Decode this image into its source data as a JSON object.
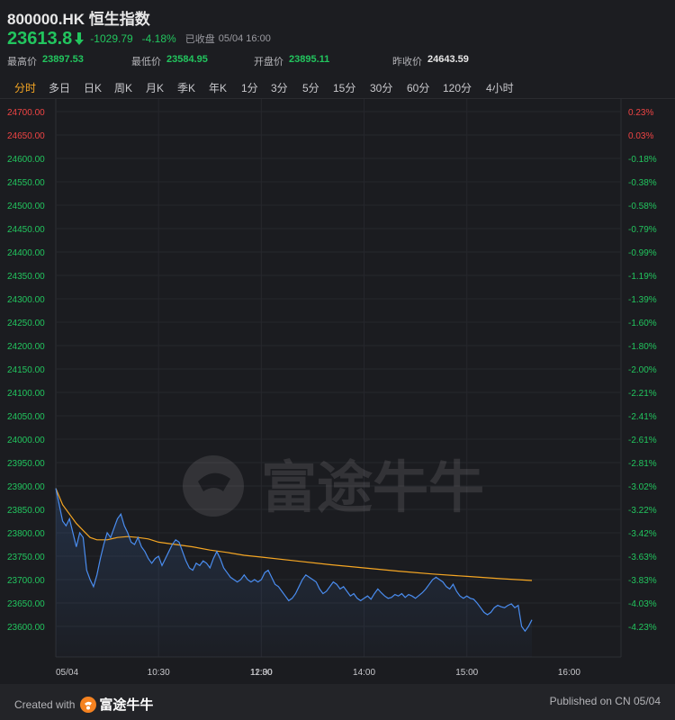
{
  "header": {
    "title": "800000.HK 恒生指数",
    "price": "23613.8",
    "change": "-1029.79",
    "change_pct": "-4.18%",
    "status": "已收盘",
    "time": "05/04 16:00",
    "stats": [
      {
        "label": "最高价",
        "value": "23897.53"
      },
      {
        "label": "最低价",
        "value": "23584.95"
      },
      {
        "label": "开盘价",
        "value": "23895.11"
      },
      {
        "label": "昨收价",
        "value": "24643.59"
      }
    ]
  },
  "tabs": [
    "分时",
    "多日",
    "日K",
    "周K",
    "月K",
    "季K",
    "年K",
    "1分",
    "3分",
    "5分",
    "15分",
    "30分",
    "60分",
    "120分",
    "4小时"
  ],
  "active_tab": "分时",
  "colors": {
    "up": "#ef4444",
    "down": "#22c55e",
    "price_line": "#4a8df0",
    "avg_line": "#f5a623",
    "active_tab": "#f5a623"
  },
  "watermark": "富途牛牛",
  "chart_data": {
    "type": "line",
    "prev_close": 24643.59,
    "ylim": [
      23575,
      24720
    ],
    "left_ticks": [
      "24700.00",
      "24650.00",
      "24600.00",
      "24550.00",
      "24500.00",
      "24450.00",
      "24400.00",
      "24350.00",
      "24300.00",
      "24250.00",
      "24200.00",
      "24150.00",
      "24100.00",
      "24050.00",
      "24000.00",
      "23950.00",
      "23900.00",
      "23850.00",
      "23800.00",
      "23750.00",
      "23700.00",
      "23650.00",
      "23600.00"
    ],
    "right_ticks": [
      "0.23%",
      "0.03%",
      "-0.18%",
      "-0.38%",
      "-0.58%",
      "-0.79%",
      "-0.99%",
      "-1.19%",
      "-1.39%",
      "-1.60%",
      "-1.80%",
      "-2.00%",
      "-2.21%",
      "-2.41%",
      "-2.61%",
      "-2.81%",
      "-3.02%",
      "-3.22%",
      "-3.42%",
      "-3.63%",
      "-3.83%",
      "-4.03%",
      "-4.23%"
    ],
    "x_labels": [
      {
        "label": "05/04",
        "t": "09:30"
      },
      {
        "label": "10:30",
        "t": "10:30"
      },
      {
        "label": "11:30",
        "t": "11:30"
      },
      {
        "label": "12:00",
        "t": "13:00"
      },
      {
        "label": "14:00",
        "t": "14:00"
      },
      {
        "label": "15:00",
        "t": "15:00"
      },
      {
        "label": "16:00",
        "t": "16:00"
      }
    ],
    "series": [
      {
        "values": [
          [
            "09:30",
            23895
          ],
          [
            "09:32",
            23860
          ],
          [
            "09:34",
            23825
          ],
          [
            "09:36",
            23815
          ],
          [
            "09:38",
            23830
          ],
          [
            "09:40",
            23800
          ],
          [
            "09:42",
            23770
          ],
          [
            "09:44",
            23800
          ],
          [
            "09:46",
            23790
          ],
          [
            "09:48",
            23720
          ],
          [
            "09:50",
            23700
          ],
          [
            "09:52",
            23685
          ],
          [
            "09:54",
            23710
          ],
          [
            "09:56",
            23745
          ],
          [
            "09:58",
            23775
          ],
          [
            "10:00",
            23800
          ],
          [
            "10:02",
            23790
          ],
          [
            "10:04",
            23810
          ],
          [
            "10:06",
            23830
          ],
          [
            "10:08",
            23840
          ],
          [
            "10:10",
            23815
          ],
          [
            "10:12",
            23800
          ],
          [
            "10:14",
            23780
          ],
          [
            "10:16",
            23775
          ],
          [
            "10:18",
            23790
          ],
          [
            "10:20",
            23770
          ],
          [
            "10:22",
            23760
          ],
          [
            "10:24",
            23745
          ],
          [
            "10:26",
            23735
          ],
          [
            "10:28",
            23745
          ],
          [
            "10:30",
            23750
          ],
          [
            "10:32",
            23730
          ],
          [
            "10:34",
            23745
          ],
          [
            "10:36",
            23760
          ],
          [
            "10:38",
            23775
          ],
          [
            "10:40",
            23785
          ],
          [
            "10:42",
            23780
          ],
          [
            "10:44",
            23760
          ],
          [
            "10:46",
            23740
          ],
          [
            "10:48",
            23725
          ],
          [
            "10:50",
            23720
          ],
          [
            "10:52",
            23735
          ],
          [
            "10:54",
            23730
          ],
          [
            "10:56",
            23740
          ],
          [
            "10:58",
            23735
          ],
          [
            "11:00",
            23725
          ],
          [
            "11:02",
            23745
          ],
          [
            "11:04",
            23760
          ],
          [
            "11:06",
            23745
          ],
          [
            "11:08",
            23725
          ],
          [
            "11:10",
            23715
          ],
          [
            "11:12",
            23705
          ],
          [
            "11:14",
            23700
          ],
          [
            "11:16",
            23695
          ],
          [
            "11:18",
            23700
          ],
          [
            "11:20",
            23710
          ],
          [
            "11:22",
            23700
          ],
          [
            "11:24",
            23695
          ],
          [
            "11:26",
            23700
          ],
          [
            "11:28",
            23695
          ],
          [
            "11:30",
            23700
          ],
          [
            "13:00",
            23700
          ],
          [
            "13:02",
            23715
          ],
          [
            "13:04",
            23720
          ],
          [
            "13:06",
            23705
          ],
          [
            "13:08",
            23690
          ],
          [
            "13:10",
            23685
          ],
          [
            "13:12",
            23675
          ],
          [
            "13:14",
            23665
          ],
          [
            "13:16",
            23655
          ],
          [
            "13:18",
            23660
          ],
          [
            "13:20",
            23670
          ],
          [
            "13:22",
            23685
          ],
          [
            "13:24",
            23700
          ],
          [
            "13:26",
            23710
          ],
          [
            "13:28",
            23705
          ],
          [
            "13:30",
            23700
          ],
          [
            "13:32",
            23695
          ],
          [
            "13:34",
            23680
          ],
          [
            "13:36",
            23670
          ],
          [
            "13:38",
            23675
          ],
          [
            "13:40",
            23685
          ],
          [
            "13:42",
            23695
          ],
          [
            "13:44",
            23690
          ],
          [
            "13:46",
            23680
          ],
          [
            "13:48",
            23685
          ],
          [
            "13:50",
            23675
          ],
          [
            "13:52",
            23665
          ],
          [
            "13:54",
            23670
          ],
          [
            "13:56",
            23660
          ],
          [
            "13:58",
            23655
          ],
          [
            "14:00",
            23660
          ],
          [
            "14:02",
            23665
          ],
          [
            "14:04",
            23658
          ],
          [
            "14:06",
            23670
          ],
          [
            "14:08",
            23680
          ],
          [
            "14:10",
            23672
          ],
          [
            "14:12",
            23665
          ],
          [
            "14:14",
            23660
          ],
          [
            "14:16",
            23662
          ],
          [
            "14:18",
            23668
          ],
          [
            "14:20",
            23665
          ],
          [
            "14:22",
            23670
          ],
          [
            "14:24",
            23662
          ],
          [
            "14:26",
            23668
          ],
          [
            "14:28",
            23665
          ],
          [
            "14:30",
            23660
          ],
          [
            "14:32",
            23666
          ],
          [
            "14:34",
            23672
          ],
          [
            "14:36",
            23680
          ],
          [
            "14:38",
            23690
          ],
          [
            "14:40",
            23700
          ],
          [
            "14:42",
            23705
          ],
          [
            "14:44",
            23700
          ],
          [
            "14:46",
            23695
          ],
          [
            "14:48",
            23685
          ],
          [
            "14:50",
            23680
          ],
          [
            "14:52",
            23690
          ],
          [
            "14:54",
            23675
          ],
          [
            "14:56",
            23665
          ],
          [
            "14:58",
            23660
          ],
          [
            "15:00",
            23665
          ],
          [
            "15:02",
            23660
          ],
          [
            "15:04",
            23658
          ],
          [
            "15:06",
            23650
          ],
          [
            "15:08",
            23640
          ],
          [
            "15:10",
            23630
          ],
          [
            "15:12",
            23625
          ],
          [
            "15:14",
            23630
          ],
          [
            "15:16",
            23640
          ],
          [
            "15:18",
            23645
          ],
          [
            "15:20",
            23642
          ],
          [
            "15:22",
            23640
          ],
          [
            "15:24",
            23645
          ],
          [
            "15:26",
            23648
          ],
          [
            "15:28",
            23640
          ],
          [
            "15:30",
            23645
          ],
          [
            "15:32",
            23600
          ],
          [
            "15:34",
            23590
          ],
          [
            "15:36",
            23600
          ],
          [
            "15:38",
            23614
          ]
        ]
      },
      {
        "values": [
          [
            "09:30",
            23895
          ],
          [
            "09:34",
            23860
          ],
          [
            "09:38",
            23840
          ],
          [
            "09:42",
            23820
          ],
          [
            "09:46",
            23805
          ],
          [
            "09:50",
            23790
          ],
          [
            "09:54",
            23785
          ],
          [
            "10:00",
            23785
          ],
          [
            "10:06",
            23790
          ],
          [
            "10:12",
            23792
          ],
          [
            "10:18",
            23790
          ],
          [
            "10:24",
            23787
          ],
          [
            "10:30",
            23780
          ],
          [
            "10:40",
            23775
          ],
          [
            "10:50",
            23770
          ],
          [
            "11:00",
            23763
          ],
          [
            "11:10",
            23758
          ],
          [
            "11:20",
            23752
          ],
          [
            "11:30",
            23748
          ],
          [
            "13:00",
            23748
          ],
          [
            "13:20",
            23740
          ],
          [
            "13:40",
            23732
          ],
          [
            "14:00",
            23725
          ],
          [
            "14:20",
            23718
          ],
          [
            "14:40",
            23712
          ],
          [
            "15:00",
            23707
          ],
          [
            "15:20",
            23702
          ],
          [
            "15:38",
            23698
          ]
        ]
      }
    ]
  },
  "footer": {
    "created_with": "Created with",
    "brand": "富途牛牛",
    "published": "Published on CN 05/04"
  }
}
